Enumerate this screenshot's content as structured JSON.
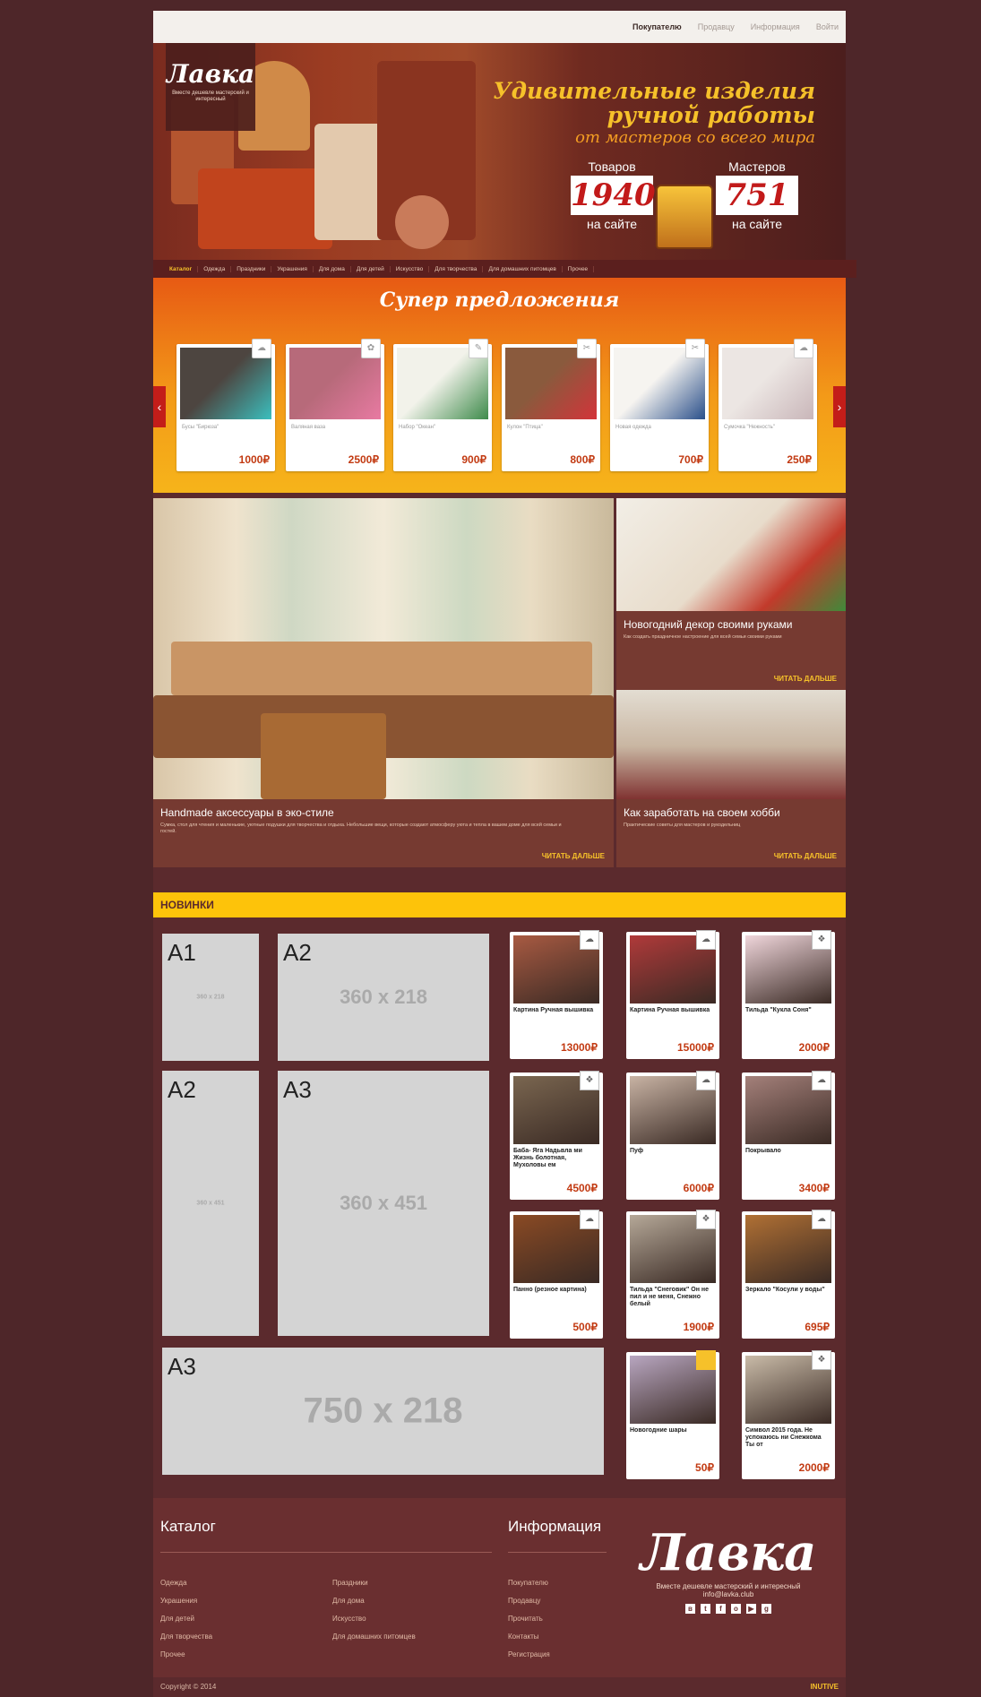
{
  "topnav": [
    "Покупателю",
    "Продавцу",
    "Информация",
    "Войти"
  ],
  "logo": {
    "word": "Лавка",
    "tagline": "Вместе дешевле мастерский и интересный"
  },
  "hero": {
    "title_line1": "Удивительные изделия",
    "title_line2": "ручной работы",
    "subtitle": "от мастеров со всего мира",
    "stat1": {
      "label": "Товаров",
      "value": "1940",
      "sub": "на сайте"
    },
    "stat2": {
      "label": "Мастеров",
      "value": "751",
      "sub": "на сайте"
    }
  },
  "catnav": [
    "Каталог",
    "Одежда",
    "Праздники",
    "Украшения",
    "Для дома",
    "Для детей",
    "Искусство",
    "Для творчества",
    "Для домашних питомцев",
    "Прочее"
  ],
  "offers": {
    "title": "Супер предложения",
    "prev": "‹",
    "next": "›",
    "items": [
      {
        "name": "Бусы \"Бирюза\"",
        "price": "1000₽",
        "color": "#4d4540",
        "accent": "#3bbfbe",
        "badge": "☁"
      },
      {
        "name": "Валяная ваза",
        "price": "2500₽",
        "color": "#b76a7a",
        "accent": "#e87aa2",
        "badge": "✿"
      },
      {
        "name": "Набор \"Океан\"",
        "price": "900₽",
        "color": "#f2f2ea",
        "accent": "#3d8a4a",
        "badge": "✎"
      },
      {
        "name": "Кулон \"Птица\"",
        "price": "800₽",
        "color": "#8a5a3d",
        "accent": "#d3343a",
        "badge": "✂"
      },
      {
        "name": "Новая одежда",
        "price": "700₽",
        "color": "#f6f4f0",
        "accent": "#2a4f8a",
        "badge": "✂"
      },
      {
        "name": "Сумочка \"Нежность\"",
        "price": "250₽",
        "color": "#ece6e3",
        "accent": "#c9b6b9",
        "badge": "☁"
      }
    ]
  },
  "articles": {
    "main": {
      "title": "Handmade аксессуары в эко-стиле",
      "desc": "Сумка, стол для чтения и маленькие, уютные подушки для творчества и отдыха. Небольшие вещи, которые создают атмосферу уюта и тепла в вашем доме для всей семьи и гостей.",
      "more": "ЧИТАТЬ ДАЛЬШЕ"
    },
    "side1": {
      "title": "Новогодний декор своими руками",
      "desc": "Как создать праздничное настроение для всей семьи своими руками",
      "more": "ЧИТАТЬ ДАЛЬШЕ"
    },
    "side2": {
      "title": "Как заработать на своем хобби",
      "desc": "Практические советы для мастеров и рукодельниц",
      "more": "ЧИТАТЬ ДАЛЬШЕ"
    }
  },
  "new_items": {
    "header": "НОВИНКИ",
    "ads": [
      {
        "code": "A1",
        "size": "360 x 218"
      },
      {
        "code": "A2",
        "size": "360 x 218"
      },
      {
        "code": "A2",
        "size": "360 x 451"
      },
      {
        "code": "A3",
        "size": "360 x 451"
      },
      {
        "code": "A3",
        "size": "750 x 218"
      }
    ],
    "products": [
      {
        "name": "Картина Ручная вышивка",
        "price": "13000₽",
        "color": "#a85a42",
        "badge": "☁"
      },
      {
        "name": "Картина Ручная вышивка",
        "price": "15000₽",
        "color": "#b03a3a",
        "badge": "☁"
      },
      {
        "name": "Тильда \"Кукла Соня\"",
        "price": "2000₽",
        "color": "#f0d6db",
        "badge": "❖"
      },
      {
        "name": "Баба- Яга Надьвла ми Жизнь болотная, Мухоловы ем",
        "price": "4500₽",
        "color": "#7a6650",
        "badge": "❖"
      },
      {
        "name": "Пуф",
        "price": "6000₽",
        "color": "#c8b3a4",
        "badge": "☁"
      },
      {
        "name": "Покрывало",
        "price": "3400₽",
        "color": "#a4807a",
        "badge": "☁"
      },
      {
        "name": "Панно (резное картина)",
        "price": "500₽",
        "color": "#8a4a24",
        "badge": "☁"
      },
      {
        "name": "Тильда \"Снеговик\" Он не пил и не меня, Снежно белый",
        "price": "1900₽",
        "color": "#b5a898",
        "badge": "❖"
      },
      {
        "name": "Зеркало \"Косули у воды\"",
        "price": "695₽",
        "color": "#b07034",
        "badge": "☁"
      },
      {
        "name": "Новогодние шары",
        "price": "50₽",
        "color": "#b8a6c0",
        "badge": "■"
      },
      {
        "name": "Символ 2015 года. Не успокаюсь ни Снежкома Ты от",
        "price": "2000₽",
        "color": "#c9bba8",
        "badge": "❖"
      }
    ]
  },
  "footer": {
    "catalog_title": "Каталог",
    "info_title": "Информация",
    "catalog_col1": [
      "Одежда",
      "Украшения",
      "Для детей",
      "Для творчества",
      "Прочее"
    ],
    "catalog_col2": [
      "Праздники",
      "Для дома",
      "Искусство",
      "Для домашних питомцев"
    ],
    "info_links": [
      "Покупателю",
      "Продавцу",
      "Прочитать",
      "Контакты",
      "Регистрация"
    ],
    "logo_word": "Лавка",
    "logo_tagline": "Вместе дешевле мастерский и интересный",
    "site": "info@lavka.club",
    "social": [
      "vk",
      "tw",
      "fb",
      "ok",
      "yt",
      "gp"
    ]
  },
  "copyright": "Copyright © 2014",
  "studio": "INUTIVE"
}
